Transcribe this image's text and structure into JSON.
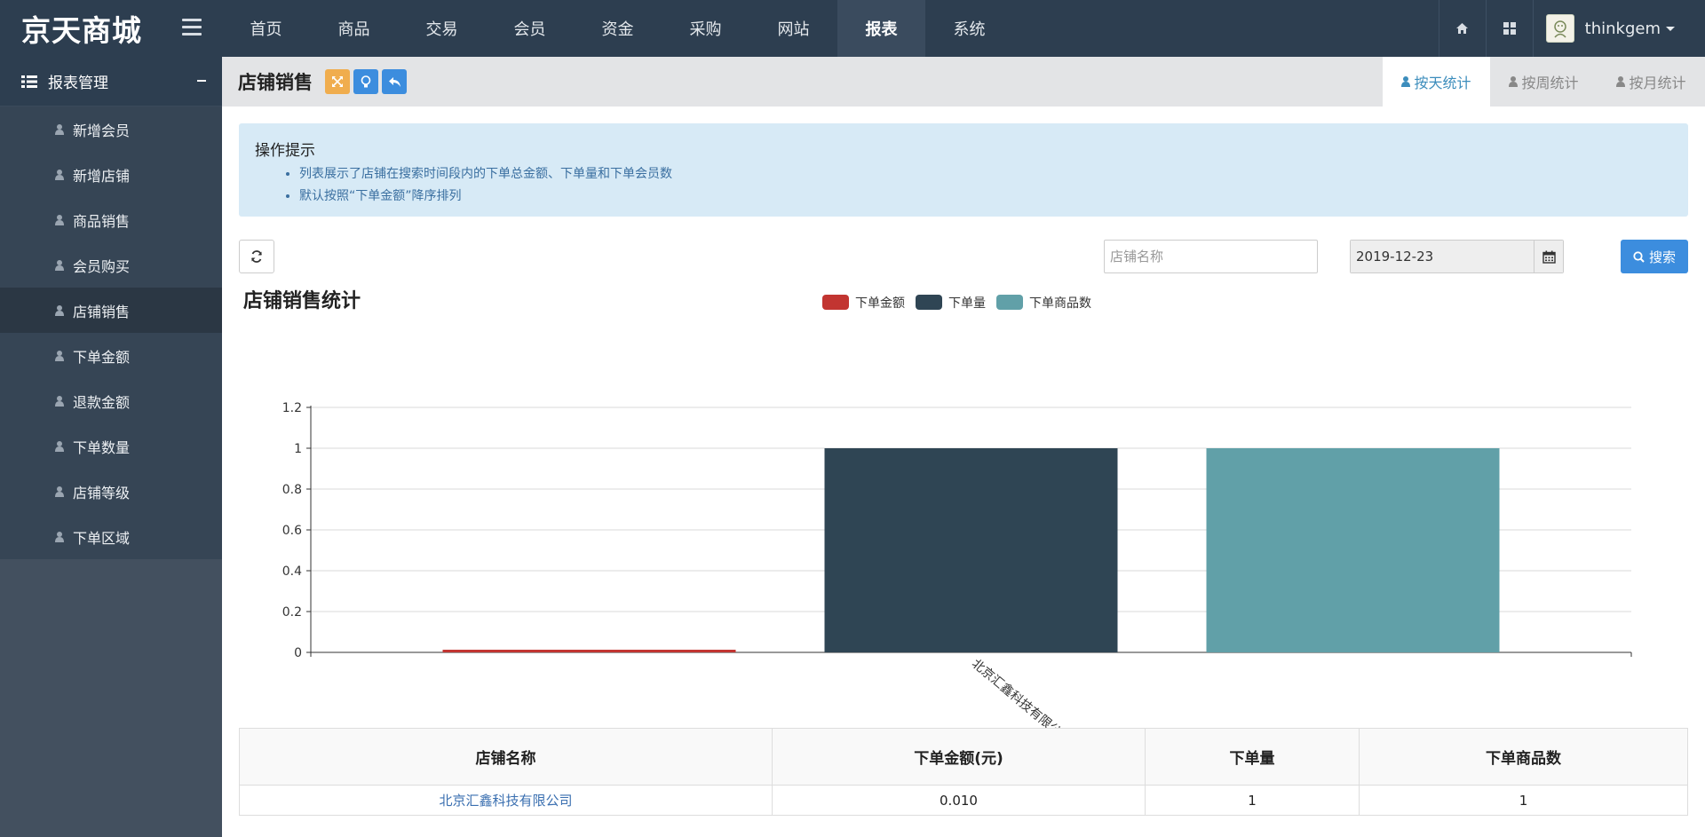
{
  "app": {
    "brand": "京天商城",
    "nav": [
      "首页",
      "商品",
      "交易",
      "会员",
      "资金",
      "采购",
      "网站",
      "报表",
      "系统"
    ],
    "nav_active_index": 7,
    "user": "thinkgem"
  },
  "sidebar": {
    "title": "报表管理",
    "items": [
      {
        "label": "新增会员"
      },
      {
        "label": "新增店铺"
      },
      {
        "label": "商品销售"
      },
      {
        "label": "会员购买"
      },
      {
        "label": "店铺销售",
        "active": true
      },
      {
        "label": "下单金额"
      },
      {
        "label": "退款金额"
      },
      {
        "label": "下单数量"
      },
      {
        "label": "店铺等级"
      },
      {
        "label": "下单区域"
      }
    ]
  },
  "page": {
    "title": "店铺销售",
    "tabs": [
      {
        "label": "按天统计",
        "active": true
      },
      {
        "label": "按周统计"
      },
      {
        "label": "按月统计"
      }
    ]
  },
  "tips": {
    "title": "操作提示",
    "items": [
      "列表展示了店铺在搜索时间段内的下单总金额、下单量和下单会员数",
      "默认按照“下单金额”降序排列"
    ]
  },
  "filters": {
    "store_placeholder": "店铺名称",
    "date_value": "2019-12-23",
    "search_label": "搜索"
  },
  "chart_data": {
    "type": "bar",
    "title": "店铺销售统计",
    "categories": [
      "北京汇鑫科技有限公司"
    ],
    "series": [
      {
        "name": "下单金额",
        "values": [
          0.01
        ],
        "color": "#c23531"
      },
      {
        "name": "下单量",
        "values": [
          1
        ],
        "color": "#2f4554"
      },
      {
        "name": "下单商品数",
        "values": [
          1
        ],
        "color": "#61a0a8"
      }
    ],
    "ylim": [
      0,
      1.2
    ],
    "yticks": [
      "0",
      "0.2",
      "0.4",
      "0.6",
      "0.8",
      "1",
      "1.2"
    ],
    "grid": true,
    "legend": "top-center"
  },
  "table": {
    "headers": [
      "店铺名称",
      "下单金额(元)",
      "下单量",
      "下单商品数"
    ],
    "rows": [
      [
        "北京汇鑫科技有限公司",
        "0.010",
        "1",
        "1"
      ]
    ]
  },
  "colors": {
    "topbar": "#2d3e50",
    "accent": "#3c8dde",
    "sidebar": "#43505f"
  }
}
